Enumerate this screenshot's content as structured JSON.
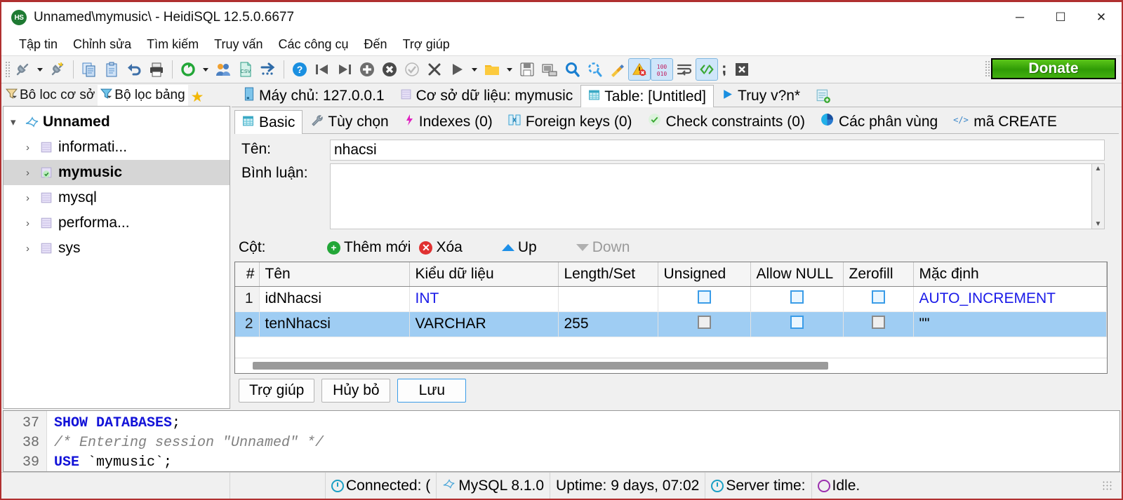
{
  "window": {
    "title": "Unnamed\\mymusic\\ - HeidiSQL 12.5.0.6677",
    "logo_text": "HS",
    "minimize": "─",
    "maximize": "☐",
    "close": "✕"
  },
  "menu": {
    "items": [
      {
        "label": "Tập tin"
      },
      {
        "label": "Chỉnh sửa"
      },
      {
        "label": "Tìm kiếm"
      },
      {
        "label": "Truy vấn"
      },
      {
        "label": "Các công cụ"
      },
      {
        "label": "Đến"
      },
      {
        "label": "Trợ giúp"
      }
    ]
  },
  "toolbar": {
    "donate_label": "Donate",
    "buttons": [
      {
        "name": "connect-icon"
      },
      {
        "name": "connect-dropdown-icon"
      },
      {
        "name": "disconnect-icon"
      },
      {
        "name": "copy-icon"
      },
      {
        "name": "paste-icon"
      },
      {
        "name": "undo-icon"
      },
      {
        "name": "print-icon"
      },
      {
        "name": "refresh-icon"
      },
      {
        "name": "refresh-dropdown-icon"
      },
      {
        "name": "users-icon"
      },
      {
        "name": "csv-export-icon"
      },
      {
        "name": "import-icon"
      },
      {
        "name": "help-icon"
      },
      {
        "name": "first-row-icon"
      },
      {
        "name": "last-row-icon"
      },
      {
        "name": "insert-row-icon"
      },
      {
        "name": "delete-row-icon"
      },
      {
        "name": "post-changes-icon"
      },
      {
        "name": "cancel-changes-icon"
      },
      {
        "name": "execute-query-icon"
      },
      {
        "name": "execute-dropdown-icon"
      },
      {
        "name": "open-file-icon"
      },
      {
        "name": "open-dropdown-icon"
      },
      {
        "name": "save-file-icon"
      },
      {
        "name": "save-snippet-icon"
      },
      {
        "name": "find-icon"
      },
      {
        "name": "find-replace-icon"
      },
      {
        "name": "format-sql-icon"
      },
      {
        "name": "stop-on-errors-icon"
      },
      {
        "name": "binary-view-icon"
      },
      {
        "name": "word-wrap-icon"
      },
      {
        "name": "syntax-check-icon"
      },
      {
        "name": "delimiter-icon"
      },
      {
        "name": "close-tab-icon"
      }
    ]
  },
  "sidebar": {
    "tabs": [
      {
        "label": "Bô loc cơ sở",
        "icon": "filter-database-icon",
        "selected": false
      },
      {
        "label": "Bộ lọc bảng",
        "icon": "filter-table-icon",
        "selected": true
      }
    ],
    "favorite_icon": "star-icon",
    "tree": [
      {
        "label": "Unnamed",
        "level": 0,
        "icon": "dolphin-icon",
        "expanded": true,
        "bold": true,
        "selected": false
      },
      {
        "label": "informati...",
        "level": 1,
        "icon": "database-icon",
        "expanded": false,
        "bold": false,
        "selected": false
      },
      {
        "label": "mymusic",
        "level": 1,
        "icon": "database-active-icon",
        "expanded": false,
        "bold": true,
        "selected": true
      },
      {
        "label": "mysql",
        "level": 1,
        "icon": "database-icon",
        "expanded": false,
        "bold": false,
        "selected": false
      },
      {
        "label": "performa...",
        "level": 1,
        "icon": "database-icon",
        "expanded": false,
        "bold": false,
        "selected": false
      },
      {
        "label": "sys",
        "level": 1,
        "icon": "database-icon",
        "expanded": false,
        "bold": false,
        "selected": false
      }
    ]
  },
  "main_tabs": [
    {
      "label": "Máy chủ: 127.0.0.1",
      "icon": "server-icon",
      "selected": false
    },
    {
      "label": "Cơ sở dữ liệu: mymusic",
      "icon": "database-icon",
      "selected": false
    },
    {
      "label": "Table: [Untitled]",
      "icon": "table-icon",
      "selected": true
    },
    {
      "label": "Truy v?n*",
      "icon": "play-icon",
      "selected": false
    }
  ],
  "new_query_tab_icon": "new-query-icon",
  "sub_tabs": [
    {
      "label": "Basic",
      "icon": "table-icon",
      "selected": true
    },
    {
      "label": "Tùy chọn",
      "icon": "wrench-icon",
      "selected": false
    },
    {
      "label": "Indexes (0)",
      "icon": "lightning-icon",
      "selected": false
    },
    {
      "label": "Foreign keys (0)",
      "icon": "foreign-key-icon",
      "selected": false
    },
    {
      "label": "Check constraints (0)",
      "icon": "check-circle-icon",
      "selected": false
    },
    {
      "label": "Các phân vùng",
      "icon": "pie-chart-icon",
      "selected": false
    },
    {
      "label": "mã CREATE",
      "icon": "code-icon",
      "selected": false
    }
  ],
  "form": {
    "name_label": "Tên:",
    "name_value": "nhacsi",
    "comment_label": "Bình luận:",
    "comment_value": ""
  },
  "columns_toolbar": {
    "label": "Cột:",
    "add_label": "Thêm mới",
    "delete_label": "Xóa",
    "up_label": "Up",
    "down_label": "Down",
    "down_disabled": true
  },
  "grid": {
    "headers": [
      "#",
      "Tên",
      "Kiểu dữ liệu",
      "Length/Set",
      "Unsigned",
      "Allow NULL",
      "Zerofill",
      "Mặc định"
    ],
    "rows": [
      {
        "num": "1",
        "name": "idNhacsi",
        "datatype": "INT",
        "length": "",
        "unsigned": false,
        "unsigned_disabled": false,
        "allow_null": false,
        "allow_null_disabled": false,
        "zerofill": false,
        "zerofill_disabled": false,
        "default": "AUTO_INCREMENT",
        "default_blue": true,
        "selected": false
      },
      {
        "num": "2",
        "name": "tenNhacsi",
        "datatype": "VARCHAR",
        "length": "255",
        "unsigned": false,
        "unsigned_disabled": true,
        "allow_null": false,
        "allow_null_disabled": false,
        "zerofill": false,
        "zerofill_disabled": true,
        "default": "\"\"",
        "default_blue": false,
        "selected": true
      }
    ]
  },
  "buttons": {
    "help": "Trợ giúp",
    "cancel": "Hủy bỏ",
    "save": "Lưu"
  },
  "sql_log": {
    "lines": [
      {
        "num": "37",
        "segments": [
          {
            "text": "SHOW DATABASES",
            "style": "kw"
          },
          {
            "text": ";",
            "style": "plain"
          }
        ]
      },
      {
        "num": "38",
        "segments": [
          {
            "text": "/* Entering session \"Unnamed\" */",
            "style": "cmt"
          }
        ]
      },
      {
        "num": "39",
        "segments": [
          {
            "text": "USE",
            "style": "kw"
          },
          {
            "text": " `mymusic`;",
            "style": "plain"
          }
        ]
      }
    ]
  },
  "status_bar": {
    "connected": "Connected: (",
    "server_version": "MySQL 8.1.0",
    "uptime": "Uptime: 9 days, 07:02",
    "server_time_label": "Server time:",
    "idle": "Idle."
  }
}
